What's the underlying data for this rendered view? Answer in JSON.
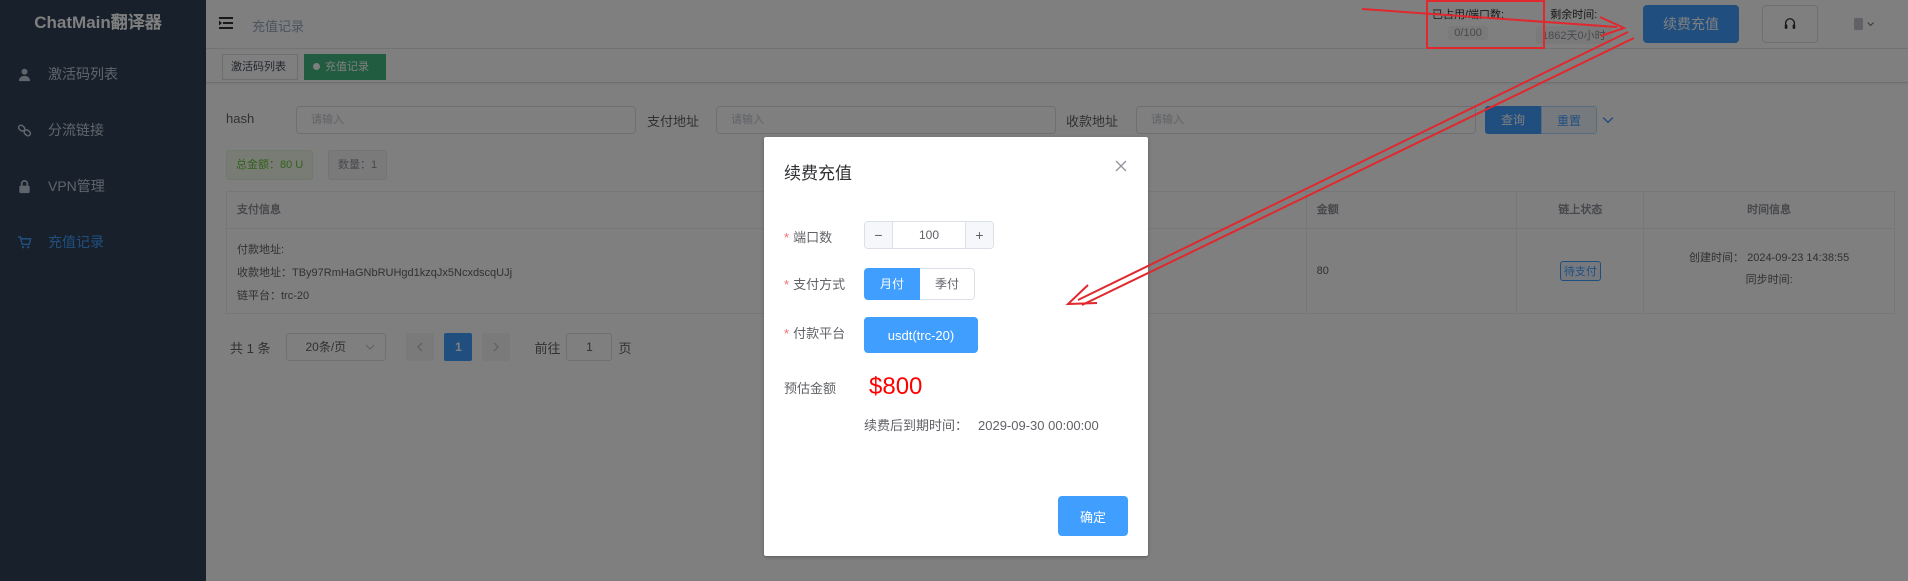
{
  "app": {
    "title": "ChatMain翻译器"
  },
  "sidebar": {
    "items": [
      {
        "label": "激活码列表",
        "icon": "user-icon",
        "active": false
      },
      {
        "label": "分流链接",
        "icon": "link-icon",
        "active": false
      },
      {
        "label": "VPN管理",
        "icon": "lock-icon",
        "active": false
      },
      {
        "label": "充值记录",
        "icon": "cart-icon",
        "active": true
      }
    ]
  },
  "header": {
    "breadcrumb": "充值记录",
    "port_label": "已占用/端口数:",
    "port_value": "0/100",
    "time_label": "剩余时间:",
    "time_value": "1862天0小时",
    "renew_button": "续费充值"
  },
  "tags": [
    {
      "label": "激活码列表",
      "active": false
    },
    {
      "label": "充值记录",
      "active": true,
      "close": "×"
    }
  ],
  "filters": {
    "hash_label": "hash",
    "hash_placeholder": "请输入",
    "pay_addr_label": "支付地址",
    "pay_addr_placeholder": "请输入",
    "recv_addr_label": "收款地址",
    "recv_addr_placeholder": "请输入",
    "query_button": "查询",
    "reset_button": "重置"
  },
  "summary": {
    "total": "总金额：80 U",
    "count": "数量：1"
  },
  "table": {
    "headers": [
      "支付信息",
      "金额",
      "链上状态",
      "时间信息"
    ],
    "rows": [
      {
        "pay_addr": "付款地址:",
        "recv_addr": "收款地址：TBy97RmHaGNbRUHgd1kzqJx5NcxdscqUJj",
        "chain": "链平台：trc-20",
        "amount": "80",
        "status": "待支付",
        "created": "创建时间：  2024-09-23 14:38:55",
        "synced": "同步时间:"
      }
    ]
  },
  "pager": {
    "total": "共 1 条",
    "page_size": "20条/页",
    "current": "1",
    "goto_label": "前往",
    "goto_value": "1",
    "page_suffix": "页"
  },
  "dialog": {
    "title": "续费充值",
    "port_label": "端口数",
    "port_value": "100",
    "minus": "−",
    "plus": "+",
    "pay_method_label": "支付方式",
    "pay_options": [
      "月付",
      "季付"
    ],
    "platform_label": "付款平台",
    "platform_value": "usdt(trc-20)",
    "estimate_label": "预估金额",
    "estimate_value": "$800",
    "expire_label": "续费后到期时间：",
    "expire_value": "2029-09-30 00:00:00",
    "confirm_button": "确定",
    "required_mark": "*"
  },
  "colors": {
    "sidebar_bg": "#304156",
    "primary": "#409eff",
    "success": "#42b983",
    "danger": "#f00",
    "annotation": "#e0282e"
  }
}
